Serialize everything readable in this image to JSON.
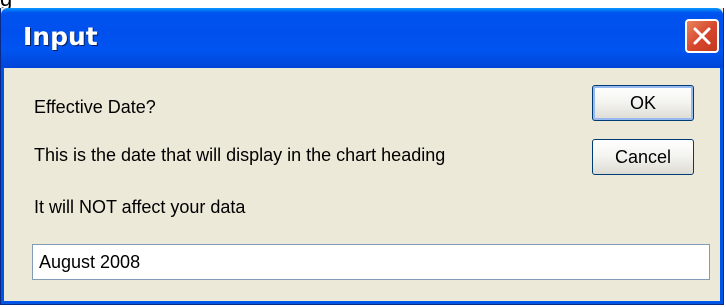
{
  "window": {
    "title": "Input",
    "close_icon": "close-icon"
  },
  "prompt": {
    "line1": "Effective Date?",
    "line2": "This is the date that will display in the chart heading",
    "line3": "It will NOT affect your data"
  },
  "buttons": {
    "ok_label": "OK",
    "cancel_label": "Cancel"
  },
  "input": {
    "value": "August 2008"
  },
  "colors": {
    "titlebar": "#0054e3",
    "window_bg": "#ece9d8",
    "close_button": "#d6452b"
  }
}
